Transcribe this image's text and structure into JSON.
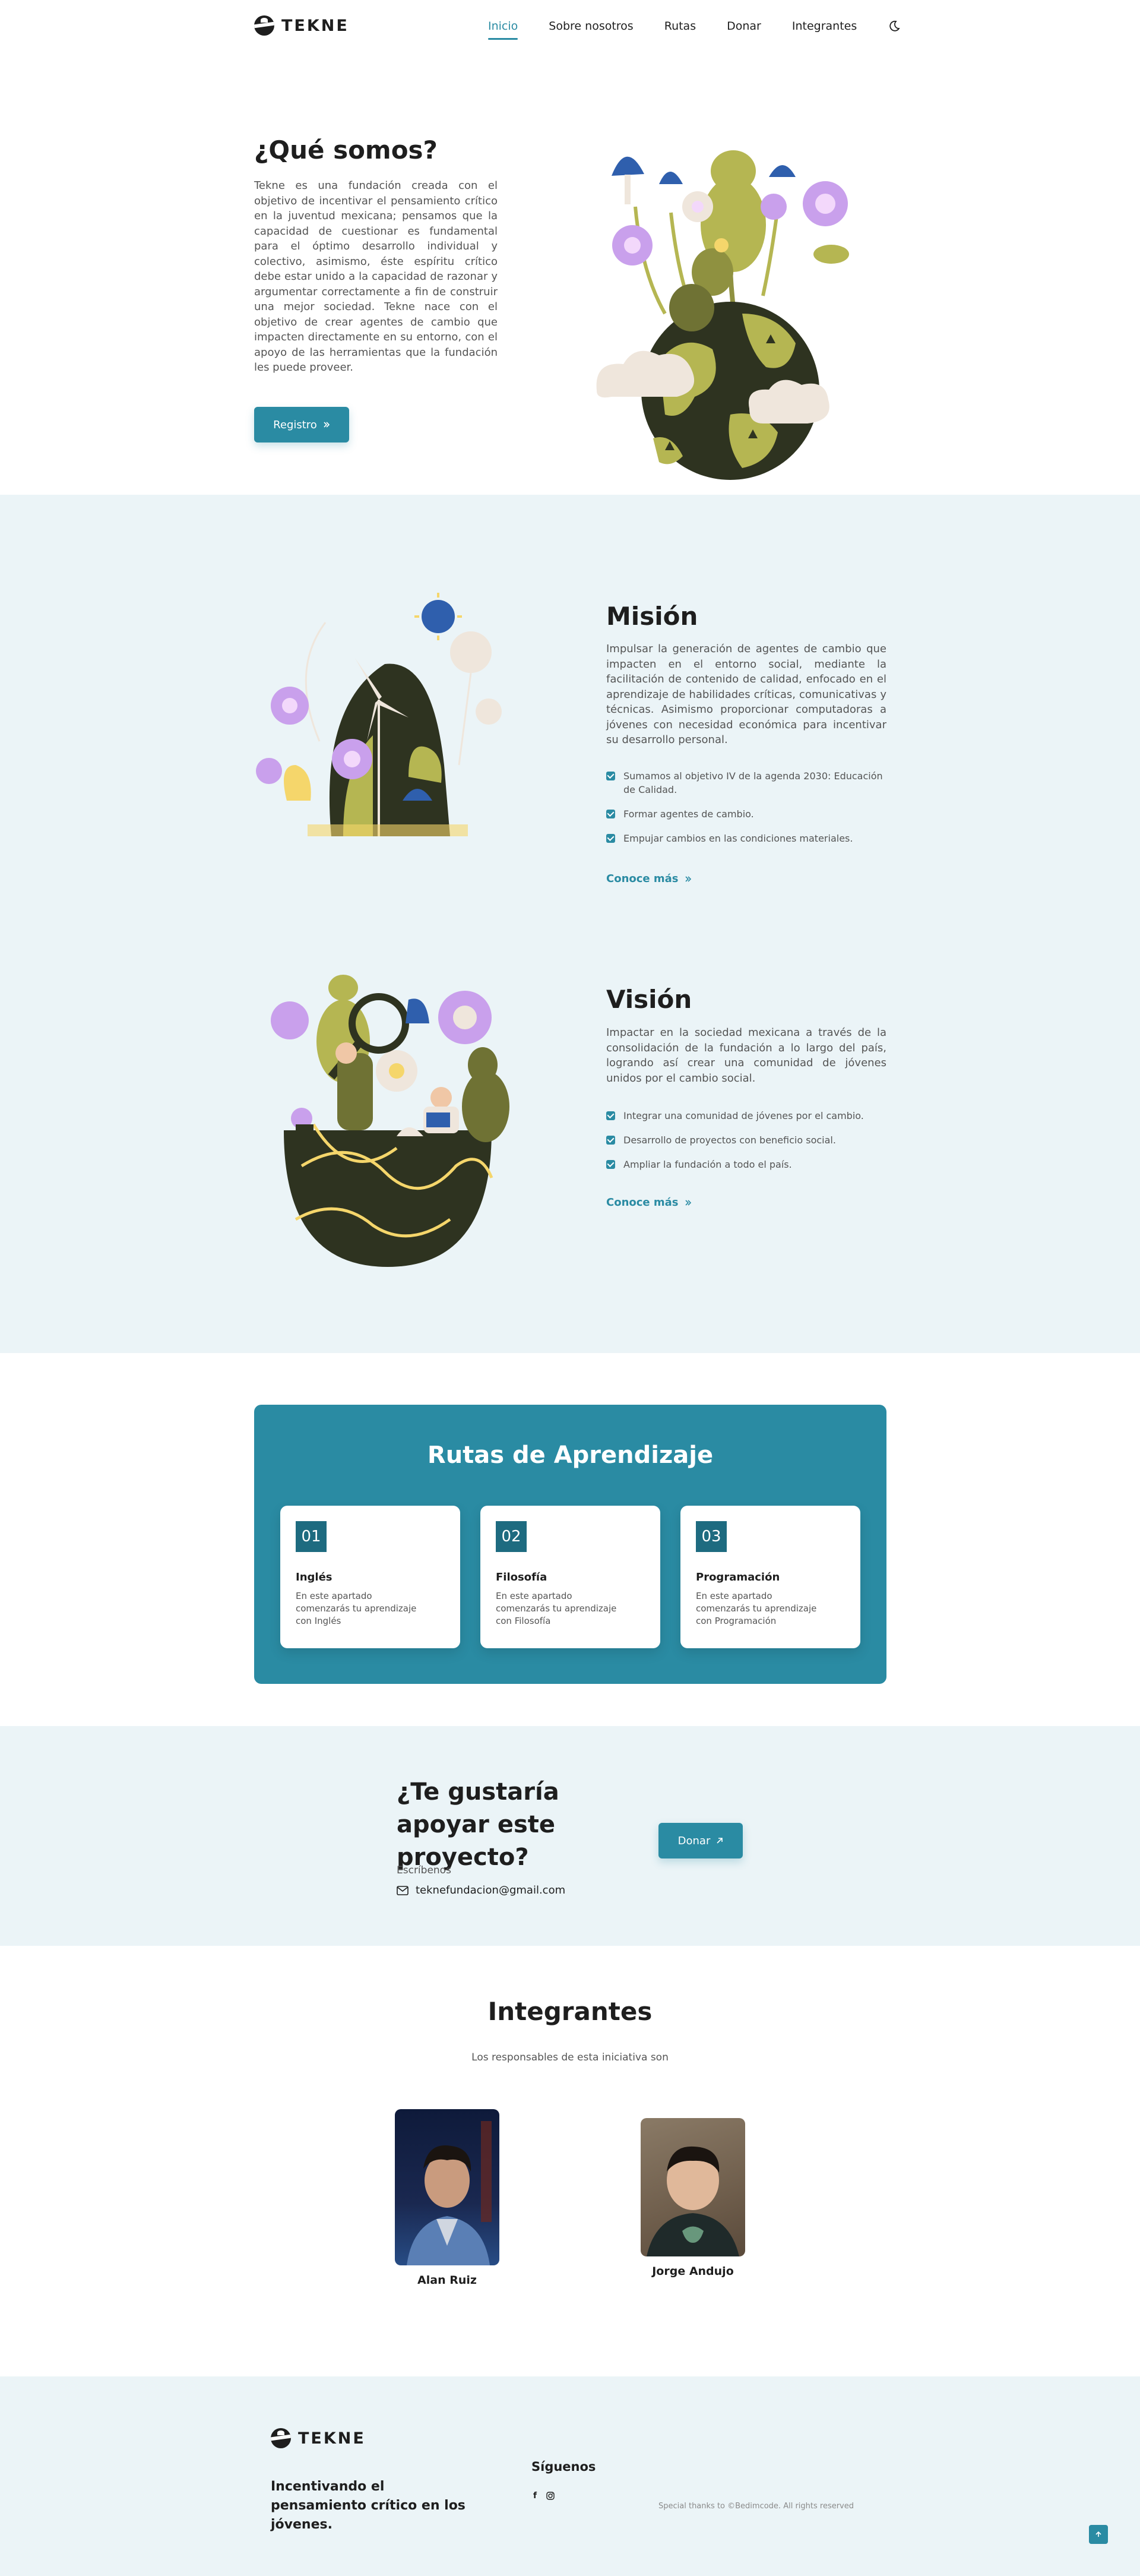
{
  "brand": {
    "name": "TEKNE"
  },
  "nav": {
    "items": [
      "Inicio",
      "Sobre nosotros",
      "Rutas",
      "Donar",
      "Integrantes"
    ],
    "active": "Inicio",
    "theme_toggle_icon": "moon-icon"
  },
  "hero": {
    "title": "¿Qué somos?",
    "description": "Tekne es una fundación creada con el objetivo de incentivar el pensamiento crítico en la juventud mexicana; pensamos que la capacidad de cuestionar es fundamental para el óptimo desarrollo individual y colectivo, asimismo, éste espíritu crítico debe estar unido a la capacidad de razonar y argumentar correctamente a fin de construir una mejor sociedad. Tekne nace con el objetivo de crear agentes de cambio que impacten directamente en su entorno, con el apoyo de las herramientas que la fundación les puede proveer.",
    "button": "Registro"
  },
  "mision": {
    "title": "Misión",
    "description": "Impulsar la generación de agentes de cambio que impacten en el entorno social, mediante la facilitación de contenido de calidad, enfocado en el aprendizaje de habilidades críticas, comunicativas y técnicas. Asimismo proporcionar computadoras a jóvenes con necesidad económica para incentivar su desarrollo personal.",
    "items": [
      "Sumamos al objetivo IV de la agenda 2030: Educación de Calidad.",
      "Formar agentes de cambio.",
      "Empujar cambios en las condiciones materiales."
    ],
    "link": "Conoce más"
  },
  "vision": {
    "title": "Visión",
    "description": "Impactar en la sociedad mexicana a través de la consolidación de la fundación a lo largo del país, logrando así crear una comunidad de jóvenes unidos por el cambio social.",
    "items": [
      "Integrar una comunidad de jóvenes por el cambio.",
      "Desarrollo de proyectos con beneficio social.",
      "Ampliar la fundación a todo el país."
    ],
    "link": "Conoce más"
  },
  "rutas": {
    "title": "Rutas de Aprendizaje",
    "cards": [
      {
        "num": "01",
        "title": "Inglés",
        "desc": "En este apartado comenzarás tu aprendizaje con Inglés"
      },
      {
        "num": "02",
        "title": "Filosofía",
        "desc": "En este apartado comenzarás tu aprendizaje con Filosofía"
      },
      {
        "num": "03",
        "title": "Programación",
        "desc": "En este apartado comenzarás tu aprendizaje con Programación"
      }
    ]
  },
  "donar": {
    "title": "¿Te gustaría apoyar este proyecto?",
    "subtitle": "Escríbenos",
    "email": "teknefundacion@gmail.com",
    "button": "Donar"
  },
  "integrantes": {
    "title": "Integrantes",
    "subtitle": "Los responsables de esta iniciativa son",
    "members": [
      {
        "name": "Alan Ruiz"
      },
      {
        "name": "Jorge Andujo"
      }
    ]
  },
  "footer": {
    "tagline": "Incentivando el pensamiento crítico en los jóvenes.",
    "social_title": "Síguenos",
    "social_icons": [
      "facebook-icon",
      "instagram-icon"
    ],
    "credits": "Special thanks to ©Bedimcode. All rights reserved"
  },
  "colors": {
    "accent": "#2a8ba3",
    "band": "#ebf4f7",
    "text": "#1e1e1e",
    "muted": "#545454",
    "olive": "#b5b652",
    "dark": "#2e3320",
    "lilac": "#c9a0ec",
    "blue": "#2f5fad"
  }
}
